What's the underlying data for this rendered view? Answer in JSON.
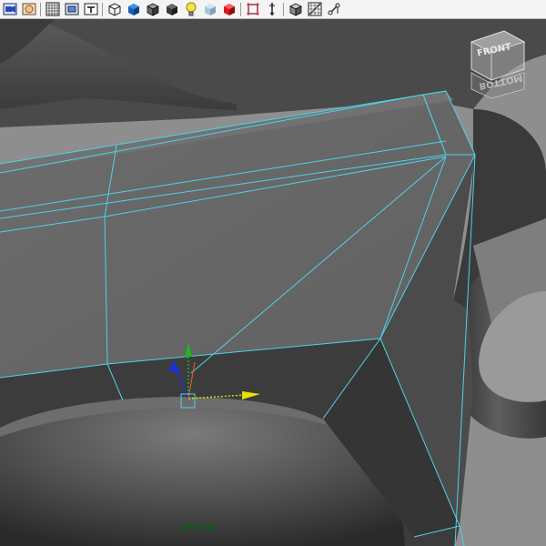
{
  "toolbar": {
    "buttons": [
      {
        "name": "select-camera-icon",
        "group": 1
      },
      {
        "name": "camera-attributes-icon",
        "group": 1
      },
      {
        "name": "grid-icon",
        "group": 1
      },
      {
        "name": "film-gate-icon",
        "group": 1
      },
      {
        "name": "resolution-gate-icon",
        "group": 1
      },
      {
        "name": "wireframe-icon",
        "group": 2
      },
      {
        "name": "smooth-shade-all-icon",
        "group": 2
      },
      {
        "name": "wireframe-on-shaded-icon",
        "group": 2
      },
      {
        "name": "xray-icon",
        "group": 2
      },
      {
        "name": "use-all-lights-icon",
        "group": 2
      },
      {
        "name": "shadows-icon",
        "group": 2
      },
      {
        "name": "textured-icon",
        "group": 2
      },
      {
        "name": "isolate-select-icon",
        "group": 3
      },
      {
        "name": "xray-joints-icon",
        "group": 3
      },
      {
        "name": "backface-culling-icon",
        "group": 3
      },
      {
        "name": "xray-active-components-icon",
        "group": 3
      }
    ]
  },
  "viewport": {
    "camera_name": "persp",
    "background_color": "#8e8e8e",
    "wireframe_color": "#4fd1e8"
  },
  "viewcube": {
    "front_label": "FRONT",
    "bottom_label": "BOTTOM"
  },
  "manipulator": {
    "x_axis_color": "#e8e000",
    "y_axis_color": "#1fb81f",
    "z_axis_color": "#1a2fd6"
  }
}
